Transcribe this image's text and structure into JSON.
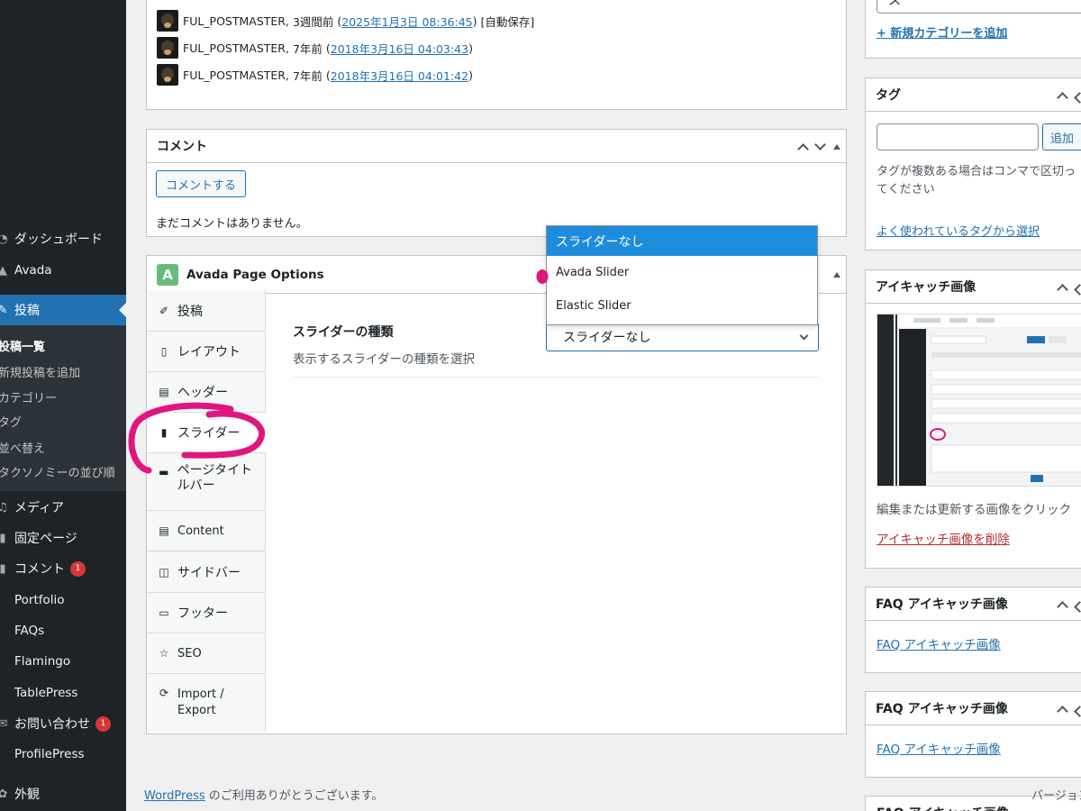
{
  "sidebar": {
    "items": [
      {
        "label": "ダッシュボード",
        "icon": "dashboard-icon"
      },
      {
        "label": "Avada",
        "icon": "avada-icon"
      },
      {
        "label": "投稿",
        "icon": "pin-icon"
      },
      {
        "label": "メディア",
        "icon": "media-icon"
      },
      {
        "label": "固定ページ",
        "icon": "page-icon"
      },
      {
        "label": "コメント",
        "icon": "comment-icon",
        "badge": "1"
      },
      {
        "label": "Portfolio",
        "icon": "portfolio-icon"
      },
      {
        "label": "FAQs",
        "icon": "faq-icon"
      },
      {
        "label": "Flamingo",
        "icon": "flamingo-icon"
      },
      {
        "label": "TablePress",
        "icon": "table-icon"
      },
      {
        "label": "お問い合わせ",
        "icon": "mail-icon",
        "badge": "1"
      },
      {
        "label": "ProfilePress",
        "icon": "profile-icon"
      },
      {
        "label": "外観",
        "icon": "appearance-icon"
      }
    ],
    "submenu": [
      "投稿一覧",
      "新規投稿を追加",
      "カテゴリー",
      "タグ",
      "並べ替え",
      "タクソノミーの並び順"
    ]
  },
  "revisions": [
    {
      "author": "FUL_POSTMASTER",
      "ago": "3週間前",
      "date": "2025年1月3日 08:36:45",
      "note": "[自動保存]"
    },
    {
      "author": "FUL_POSTMASTER",
      "ago": "7年前",
      "date": "2018年3月16日 04:03:43",
      "note": ""
    },
    {
      "author": "FUL_POSTMASTER",
      "ago": "7年前",
      "date": "2018年3月16日 04:01:42",
      "note": ""
    }
  ],
  "comments": {
    "title": "コメント",
    "button": "コメントする",
    "empty": "まだコメントはありません。"
  },
  "avada": {
    "title": "Avada Page Options",
    "tabs": [
      {
        "label": "投稿",
        "icon": "pin-icon"
      },
      {
        "label": "レイアウト",
        "icon": "document-icon"
      },
      {
        "label": "ヘッダー",
        "icon": "header-icon"
      },
      {
        "label": "スライダー",
        "icon": "slider-icon"
      },
      {
        "label": "ページタイトルバー",
        "icon": "title-bar-icon"
      },
      {
        "label": "Content",
        "icon": "content-icon"
      },
      {
        "label": "サイドバー",
        "icon": "sidebar-icon"
      },
      {
        "label": "フッター",
        "icon": "footer-icon"
      },
      {
        "label": "SEO",
        "icon": "star-icon"
      },
      {
        "label": "Import / Export",
        "icon": "sync-icon"
      }
    ],
    "field_label": "スライダーの種類",
    "field_desc": "表示するスライダーの種類を選択",
    "selected": "スライダーなし",
    "options": [
      "スライダーなし",
      "Avada Slider",
      "Elastic Slider"
    ]
  },
  "right": {
    "category_partial": "ス",
    "add_category": "+ 新規カテゴリーを追加",
    "tags_title": "タグ",
    "tags_add": "追加",
    "tags_help": "タグが複数ある場合はコンマで区切ってください",
    "tags_popular": "よく使われているタグから選択",
    "featured_title": "アイキャッチ画像",
    "featured_help": "編集または更新する画像をクリック",
    "featured_remove": "アイキャッチ画像を削除",
    "faq_title": "FAQ アイキャッチ画像",
    "faq_link": "FAQ アイキャッチ画像",
    "faq_partial": "FAQ アイキャッチ画像"
  },
  "footer": {
    "wp_link": "WordPress",
    "thanks": " のご利用ありがとうございます。",
    "version_partial": "バージョン"
  },
  "colors": {
    "accent": "#2271b1",
    "sidebar": "#1d2327",
    "annotation": "#e0167f"
  }
}
